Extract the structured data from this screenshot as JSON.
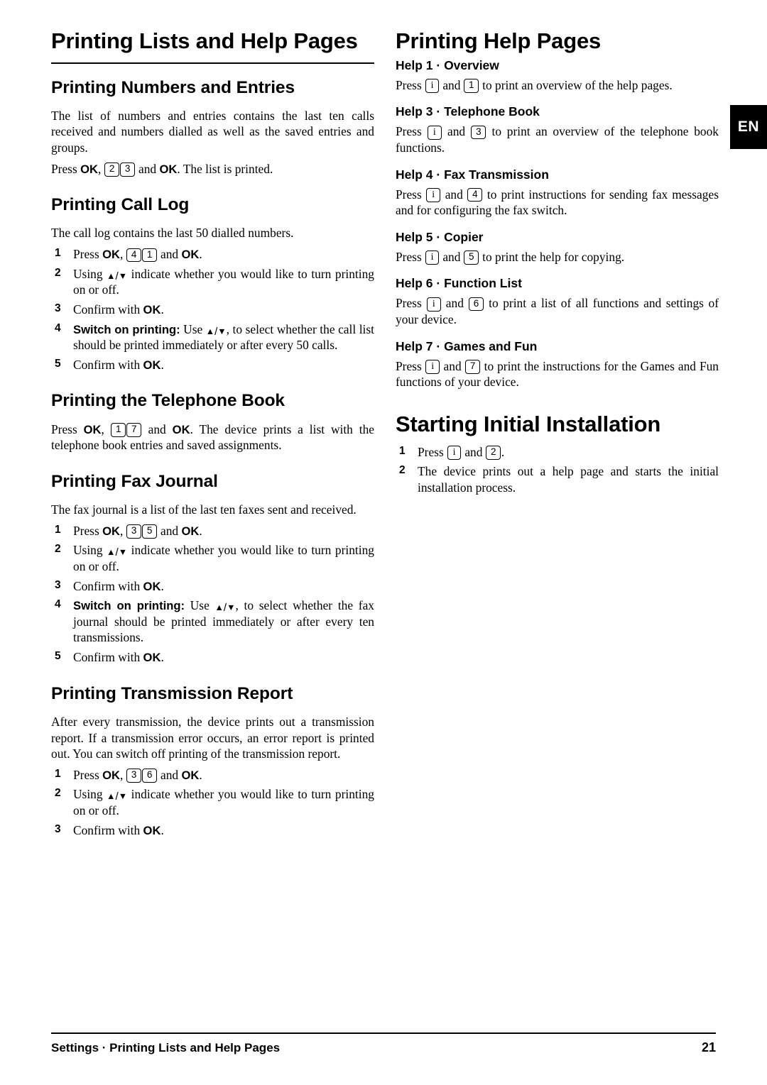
{
  "page": {
    "language_tab": "EN",
    "footer_left": "Settings · Printing Lists and Help Pages",
    "footer_page": "21"
  },
  "left_column": {
    "title": "Printing Lists and Help Pages",
    "sections": [
      {
        "heading": "Printing Numbers and Entries",
        "paragraphs": [
          "The list of numbers and entries contains the last ten calls received and numbers dialled as well as the saved entries and groups.",
          "Press OK, 2 3 and OK. The list is printed."
        ]
      },
      {
        "heading": "Printing Call Log",
        "intro": "The call log contains the last 50 dialled numbers.",
        "steps": [
          "Press OK, 4 1 and OK.",
          "Using ▲/▼ indicate whether you would like to turn printing on or off.",
          "Confirm with OK.",
          "Switch on printing: Use ▲/▼, to select whether the call list should be printed immediately or after every 50 calls.",
          "Confirm with OK."
        ]
      },
      {
        "heading": "Printing the Telephone Book",
        "paragraph": "Press OK, 1 7 and OK. The device prints a list with the telephone book entries and saved assignments."
      },
      {
        "heading": "Printing Fax Journal",
        "intro": "The fax journal is a list of the last ten faxes sent and received.",
        "steps": [
          "Press OK, 3 5 and OK.",
          "Using ▲/▼ indicate whether you would like to turn printing on or off.",
          "Confirm with OK.",
          "Switch on printing: Use ▲/▼, to select whether the fax journal should be printed immediately or after every ten transmissions.",
          "Confirm with OK."
        ]
      },
      {
        "heading": "Printing Transmission Report",
        "intro": "After every transmission, the device prints out a transmission report. If a transmission error occurs, an error report is printed out. You can switch off printing of the transmission report.",
        "steps": [
          "Press OK, 3 6 and OK.",
          "Using ▲/▼ indicate whether you would like to turn printing on or off.",
          "Confirm with OK."
        ]
      }
    ]
  },
  "right_column": {
    "title": "Printing Help Pages",
    "help_items": [
      {
        "heading": "Help 1 · Overview",
        "key": "1",
        "text_before": "Press",
        "text_mid": "and",
        "text_after": "to print an overview of the help pages."
      },
      {
        "heading": "Help 3 · Telephone Book",
        "key": "3",
        "text_before": "Press",
        "text_mid": "and",
        "text_after": "to print an overview of the telephone book functions."
      },
      {
        "heading": "Help 4 · Fax Transmission",
        "key": "4",
        "text_before": "Press",
        "text_mid": "and",
        "text_after": "to print instructions for sending fax messages and for configuring the fax switch."
      },
      {
        "heading": "Help 5 · Copier",
        "key": "5",
        "text_before": "Press",
        "text_mid": "and",
        "text_after": "to print the help for copying."
      },
      {
        "heading": "Help 6 · Function List",
        "key": "6",
        "text_before": "Press",
        "text_mid": "and",
        "text_after": "to print a list of all functions and settings of your device."
      },
      {
        "heading": "Help 7 · Games and Fun",
        "key": "7",
        "text_before": "Press",
        "text_mid": "and",
        "text_after": "to print the instructions for the Games and Fun functions of your device."
      }
    ],
    "install": {
      "title": "Starting Initial Installation",
      "step1_before": "Press",
      "step1_mid": "and",
      "step1_key": "2",
      "step1_after": ".",
      "step2": "The device prints out a help page and starts the initial installation process."
    }
  },
  "keys": {
    "info": "i",
    "ok": "OK",
    "k1": "1",
    "k2": "2",
    "k3": "3",
    "k4": "4",
    "k5": "5",
    "k6": "6",
    "k7": "7"
  }
}
